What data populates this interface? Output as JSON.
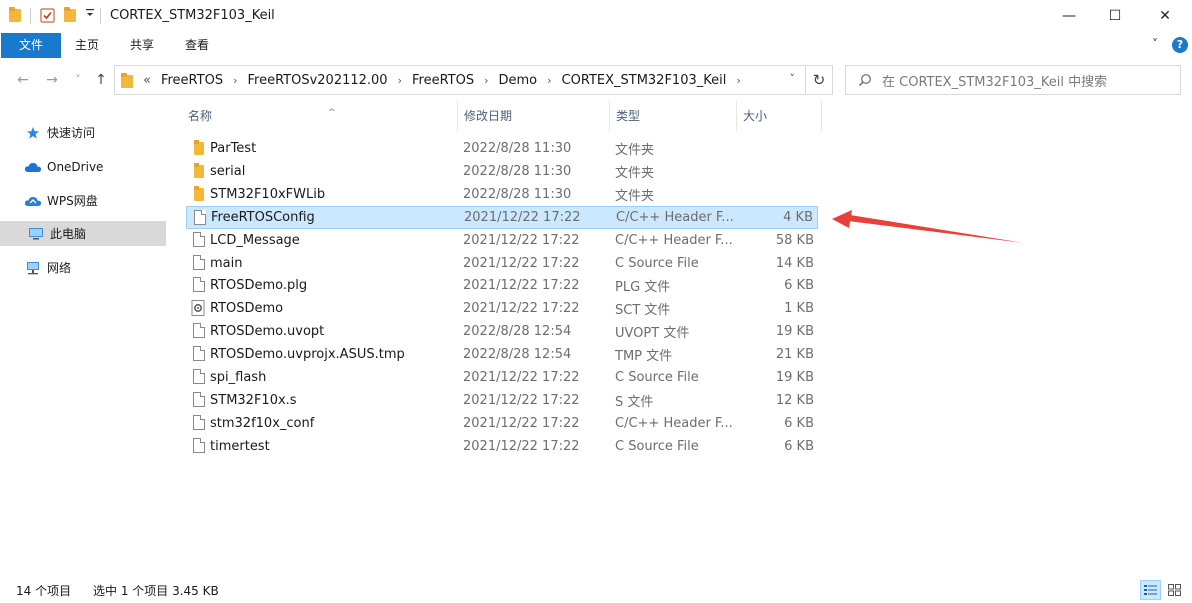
{
  "window": {
    "title": "CORTEX_STM32F103_Keil",
    "minimize_glyph": "—",
    "maximize_glyph": "☐",
    "close_glyph": "✕"
  },
  "ribbon": {
    "tabs": [
      "文件",
      "主页",
      "共享",
      "查看"
    ],
    "expand_glyph": "˅",
    "help_glyph": "?"
  },
  "nav": {
    "back_glyph": "←",
    "forward_glyph": "→",
    "recent_glyph": "˅",
    "up_glyph": "↑",
    "overflow_glyph": "«",
    "breadcrumbs": [
      "FreeRTOS",
      "FreeRTOSv202112.00",
      "FreeRTOS",
      "Demo",
      "CORTEX_STM32F103_Keil"
    ],
    "breadcrumb_sep": "›",
    "dropdown_glyph": "˅",
    "refresh_glyph": "↻",
    "search_placeholder": "在 CORTEX_STM32F103_Keil 中搜索"
  },
  "sidebar": {
    "items": [
      {
        "label": "快速访问",
        "icon": "star-icon"
      },
      {
        "label": "OneDrive",
        "icon": "cloud-icon"
      },
      {
        "label": "WPS网盘",
        "icon": "cloud-drive-icon"
      },
      {
        "label": "此电脑",
        "icon": "computer-icon"
      },
      {
        "label": "网络",
        "icon": "network-icon"
      }
    ],
    "selected_index": 3
  },
  "columns": {
    "name": "名称",
    "date": "修改日期",
    "type": "类型",
    "size": "大小",
    "sort_glyph": "^"
  },
  "files": [
    {
      "name": "ParTest",
      "date": "2022/8/28 11:30",
      "type": "文件夹",
      "size": "",
      "kind": "folder"
    },
    {
      "name": "serial",
      "date": "2022/8/28 11:30",
      "type": "文件夹",
      "size": "",
      "kind": "folder"
    },
    {
      "name": "STM32F10xFWLib",
      "date": "2022/8/28 11:30",
      "type": "文件夹",
      "size": "",
      "kind": "folder"
    },
    {
      "name": "FreeRTOSConfig",
      "date": "2021/12/22 17:22",
      "type": "C/C++ Header F...",
      "size": "4 KB",
      "kind": "file",
      "selected": true
    },
    {
      "name": "LCD_Message",
      "date": "2021/12/22 17:22",
      "type": "C/C++ Header F...",
      "size": "58 KB",
      "kind": "file"
    },
    {
      "name": "main",
      "date": "2021/12/22 17:22",
      "type": "C Source File",
      "size": "14 KB",
      "kind": "file"
    },
    {
      "name": "RTOSDemo.plg",
      "date": "2021/12/22 17:22",
      "type": "PLG 文件",
      "size": "6 KB",
      "kind": "file"
    },
    {
      "name": "RTOSDemo",
      "date": "2021/12/22 17:22",
      "type": "SCT 文件",
      "size": "1 KB",
      "kind": "script"
    },
    {
      "name": "RTOSDemo.uvopt",
      "date": "2022/8/28 12:54",
      "type": "UVOPT 文件",
      "size": "19 KB",
      "kind": "file"
    },
    {
      "name": "RTOSDemo.uvprojx.ASUS.tmp",
      "date": "2022/8/28 12:54",
      "type": "TMP 文件",
      "size": "21 KB",
      "kind": "file"
    },
    {
      "name": "spi_flash",
      "date": "2021/12/22 17:22",
      "type": "C Source File",
      "size": "19 KB",
      "kind": "file"
    },
    {
      "name": "STM32F10x.s",
      "date": "2021/12/22 17:22",
      "type": "S 文件",
      "size": "12 KB",
      "kind": "file"
    },
    {
      "name": "stm32f10x_conf",
      "date": "2021/12/22 17:22",
      "type": "C/C++ Header F...",
      "size": "6 KB",
      "kind": "file"
    },
    {
      "name": "timertest",
      "date": "2021/12/22 17:22",
      "type": "C Source File",
      "size": "6 KB",
      "kind": "file"
    }
  ],
  "status": {
    "item_count": "14 个项目",
    "selection": "选中 1 个项目 3.45 KB"
  },
  "colors": {
    "accent": "#1979ca",
    "selection_bg": "#cce8ff",
    "selection_border": "#99d1ff",
    "annotation_arrow": "#e8403a"
  }
}
